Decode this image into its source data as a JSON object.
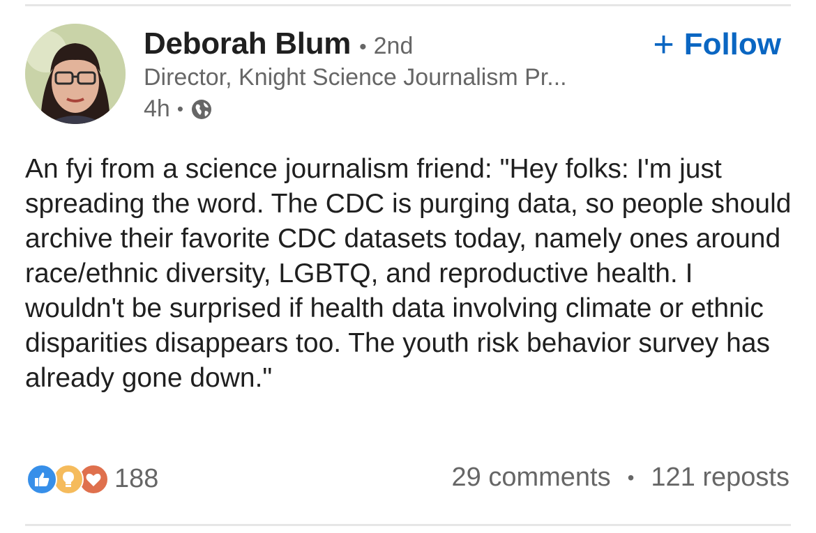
{
  "author": {
    "name": "Deborah Blum",
    "degree": "2nd",
    "headline": "Director, Knight Science Journalism Pr...",
    "time": "4h",
    "visibility_icon": "globe-icon"
  },
  "follow_label": "Follow",
  "post": {
    "text": "An fyi from a science journalism friend: \"Hey folks: I'm just spreading the word. The CDC is purging data, so people should archive their favorite CDC datasets today, namely ones around race/ethnic diversity, LGBTQ, and reproductive health. I wouldn't be surprised if health data involving climate or ethnic disparities disappears too. The youth risk behavior survey has already gone down.\""
  },
  "social": {
    "reactions_count": "188",
    "reaction_icons": [
      "like-icon",
      "insightful-icon",
      "love-icon"
    ],
    "comments": "29 comments",
    "reposts": "121 reposts"
  },
  "colors": {
    "accent": "#0a66c2",
    "like": "#378fe9",
    "insightful": "#f5bb5c",
    "love": "#df704d",
    "secondary_text": "#666666"
  }
}
